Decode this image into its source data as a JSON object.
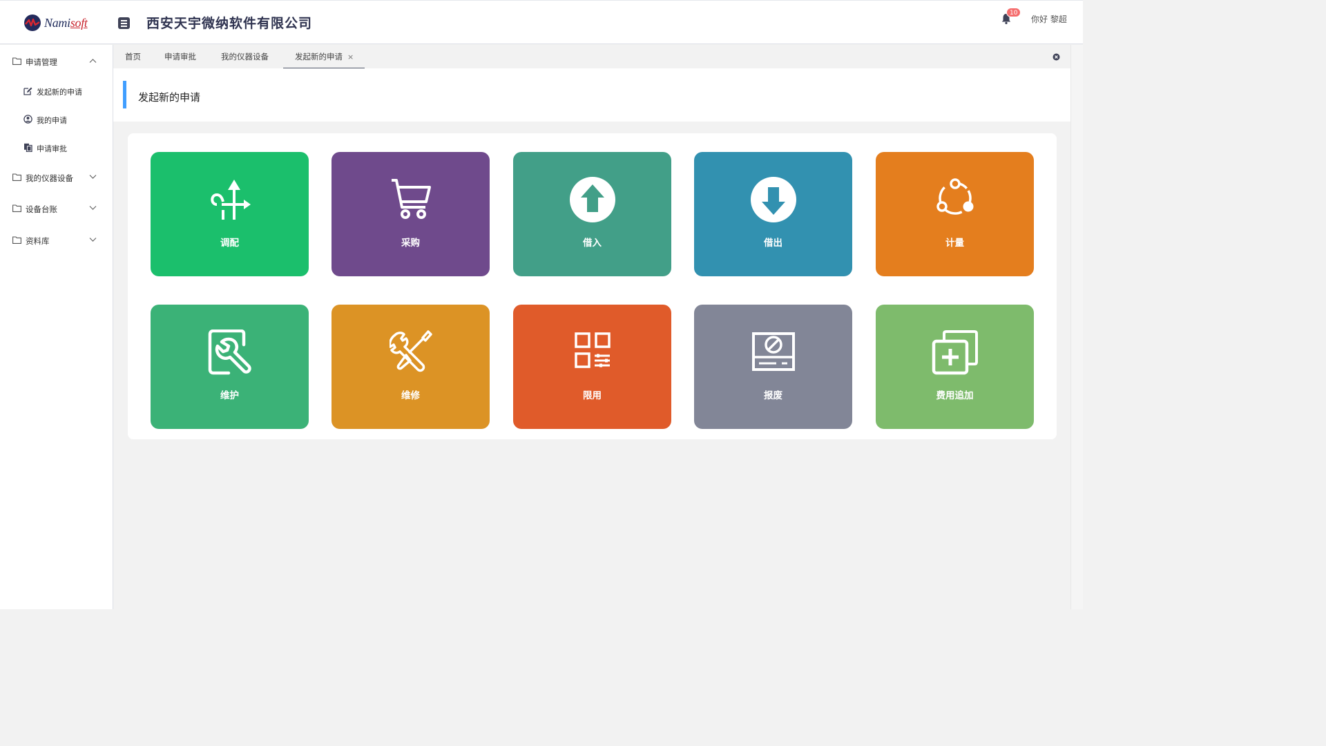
{
  "header": {
    "logo_part1": "Nami",
    "logo_part2": "soft",
    "company_name": "西安天宇微纳软件有限公司",
    "notification_count": "10",
    "greeting": "你好 黎超"
  },
  "sidebar": {
    "groups": [
      {
        "label": "申请管理",
        "expanded": true,
        "items": [
          {
            "label": "发起新的申请",
            "icon": "edit-icon"
          },
          {
            "label": "我的申请",
            "icon": "user-circle-icon"
          },
          {
            "label": "申请审批",
            "icon": "copy-icon"
          }
        ]
      },
      {
        "label": "我的仪器设备",
        "expanded": false
      },
      {
        "label": "设备台账",
        "expanded": false
      },
      {
        "label": "资料库",
        "expanded": false
      }
    ]
  },
  "tabs": [
    {
      "label": "首页"
    },
    {
      "label": "申请审批"
    },
    {
      "label": "我的仪器设备"
    },
    {
      "label": "发起新的申请",
      "active": true,
      "close": "×"
    }
  ],
  "page": {
    "title": "发起新的申请",
    "accent_color": "#409eff"
  },
  "tiles": [
    {
      "label": "调配",
      "color": "#1bbf6c",
      "icon": "transfer-arrows-icon"
    },
    {
      "label": "采购",
      "color": "#6f4a8c",
      "icon": "shopping-cart-icon"
    },
    {
      "label": "借入",
      "color": "#429f88",
      "icon": "circle-arrow-up-icon"
    },
    {
      "label": "借出",
      "color": "#3291b0",
      "icon": "circle-arrow-down-icon"
    },
    {
      "label": "计量",
      "color": "#e47e1e",
      "icon": "share-nodes-icon"
    },
    {
      "label": "维护",
      "color": "#3bb277",
      "icon": "wrench-search-icon"
    },
    {
      "label": "维修",
      "color": "#dc9325",
      "icon": "tools-icon"
    },
    {
      "label": "限用",
      "color": "#e05b2a",
      "icon": "grid-settings-icon"
    },
    {
      "label": "报废",
      "color": "#828697",
      "icon": "device-ban-icon"
    },
    {
      "label": "费用追加",
      "color": "#7ebb6c",
      "icon": "copy-plus-icon"
    }
  ]
}
